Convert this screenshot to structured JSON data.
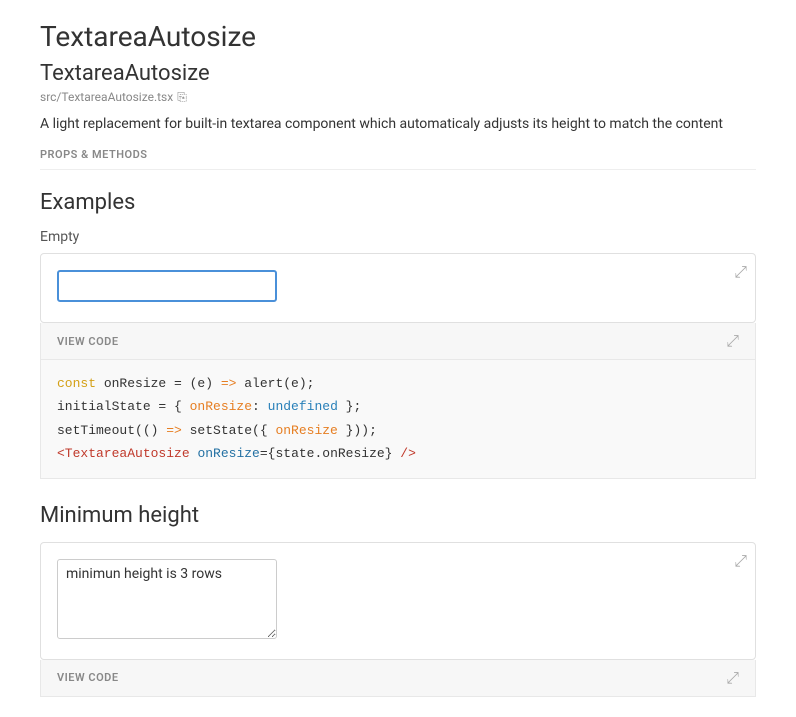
{
  "header": {
    "main_title": "TextareaAutosize",
    "section_title": "TextareaAutosize",
    "file_path": "src/TextareaAutosize.tsx",
    "description": "A light replacement for built-in textarea component which automaticaly adjusts its height to match the content",
    "props_methods_label": "PROPS & METHODS"
  },
  "examples": {
    "title": "Examples",
    "empty": {
      "label": "Empty",
      "textarea_placeholder": "",
      "textarea_value": ""
    },
    "view_code": {
      "label": "VIEW CODE",
      "lines": [
        {
          "text": "const onResize = (e) => alert(e);"
        },
        {
          "text": "initialState = { onResize: undefined };"
        },
        {
          "text": "setTimeout(() => setState({ onResize }));"
        },
        {
          "text": "<TextareaAutosize onResize={state.onResize} />"
        }
      ]
    }
  },
  "minimum_height": {
    "title": "Minimum height",
    "textarea_value": "minimun height is 3 rows",
    "view_code_label": "VIEW CODE"
  },
  "icons": {
    "expand": "⤢",
    "copy": "⎘"
  }
}
